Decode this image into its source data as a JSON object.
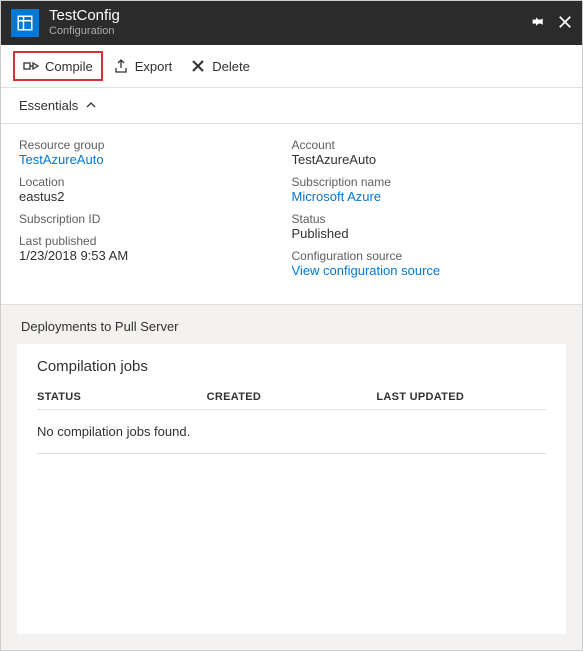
{
  "header": {
    "title": "TestConfig",
    "subtitle": "Configuration"
  },
  "toolbar": {
    "compile_label": "Compile",
    "export_label": "Export",
    "delete_label": "Delete"
  },
  "essentials": {
    "toggle_label": "Essentials",
    "left": {
      "resource_group_label": "Resource group",
      "resource_group_value": "TestAzureAuto",
      "location_label": "Location",
      "location_value": "eastus2",
      "subscription_id_label": "Subscription ID",
      "subscription_id_value": "",
      "last_published_label": "Last published",
      "last_published_value": "1/23/2018 9:53 AM"
    },
    "right": {
      "account_label": "Account",
      "account_value": "TestAzureAuto",
      "subscription_name_label": "Subscription name",
      "subscription_name_value": "Microsoft Azure",
      "status_label": "Status",
      "status_value": "Published",
      "config_source_label": "Configuration source",
      "config_source_value": "View configuration source"
    }
  },
  "deployments": {
    "section_title": "Deployments to Pull Server",
    "jobs_title": "Compilation jobs",
    "columns": {
      "status": "STATUS",
      "created": "CREATED",
      "last_updated": "LAST UPDATED"
    },
    "empty_message": "No compilation jobs found."
  }
}
